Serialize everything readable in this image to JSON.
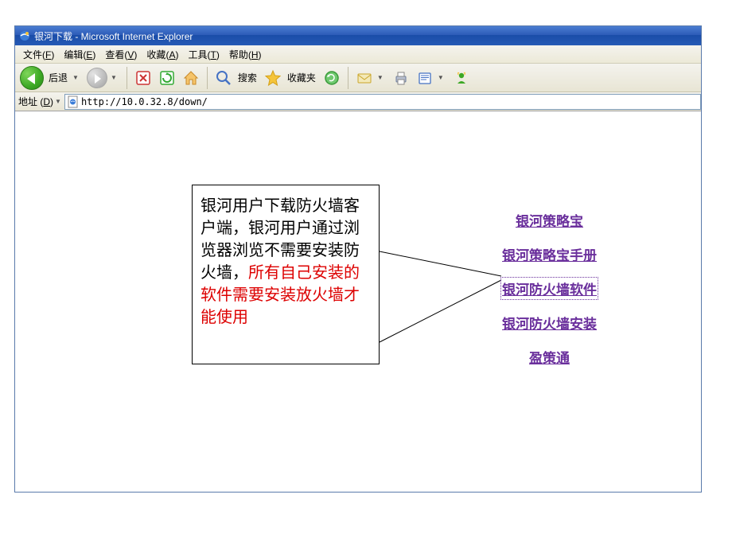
{
  "window": {
    "title": "银河下载 - Microsoft Internet Explorer"
  },
  "menu": {
    "file": {
      "label": "文件",
      "accel": "F"
    },
    "edit": {
      "label": "编辑",
      "accel": "E"
    },
    "view": {
      "label": "查看",
      "accel": "V"
    },
    "fav": {
      "label": "收藏",
      "accel": "A"
    },
    "tools": {
      "label": "工具",
      "accel": "T"
    },
    "help": {
      "label": "帮助",
      "accel": "H"
    }
  },
  "toolbar": {
    "back_label": "后退",
    "search_label": "搜索",
    "fav_label": "收藏夹"
  },
  "addressbar": {
    "label": "地址",
    "accel": "D",
    "url": "http://10.0.32.8/down/"
  },
  "callout": {
    "black": "银河用户下载防火墙客户端，银河用户通过浏览器浏览不需要安装防火墙，",
    "red": "所有自己安装的软件需要安装放火墙才能使用"
  },
  "links": {
    "item1": "银河策略宝",
    "item2": "银河策略宝手册",
    "item3": "银河防火墙软件",
    "item4": "银河防火墙安装",
    "item5": "盈策通"
  }
}
